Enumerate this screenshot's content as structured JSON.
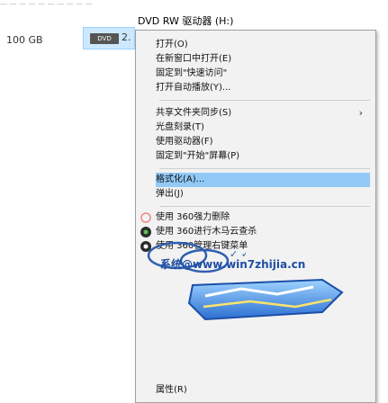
{
  "explorer": {
    "top_partial_text": "— — — — — — — — — —",
    "drive_title": "DVD RW 驱动器 (H:)",
    "left_size": "100 GB",
    "drive_icon_label": "DVD",
    "drive_size_partial": "2."
  },
  "menu": {
    "items": [
      {
        "label": "打开(O)"
      },
      {
        "label": "在新窗口中打开(E)"
      },
      {
        "label": "固定到\"快速访问\""
      },
      {
        "label": "打开自动播放(Y)..."
      },
      {
        "label": "共享文件夹同步(S)",
        "has_submenu": true
      },
      {
        "label": "光盘刻录(T)"
      },
      {
        "label": "使用驱动器(F)"
      },
      {
        "label": "固定到\"开始\"屏幕(P)"
      },
      {
        "label": "格式化(A)..."
      },
      {
        "label": "弹出(J)"
      },
      {
        "label": "使用 360强力删除"
      },
      {
        "label": "使用 360进行木马云查杀"
      },
      {
        "label": "使用 360管理右键菜单"
      }
    ],
    "bottom_item": "属性(R)"
  },
  "watermark": {
    "url": "@www.win7zhijia.cn",
    "url_prefix": "系统"
  }
}
